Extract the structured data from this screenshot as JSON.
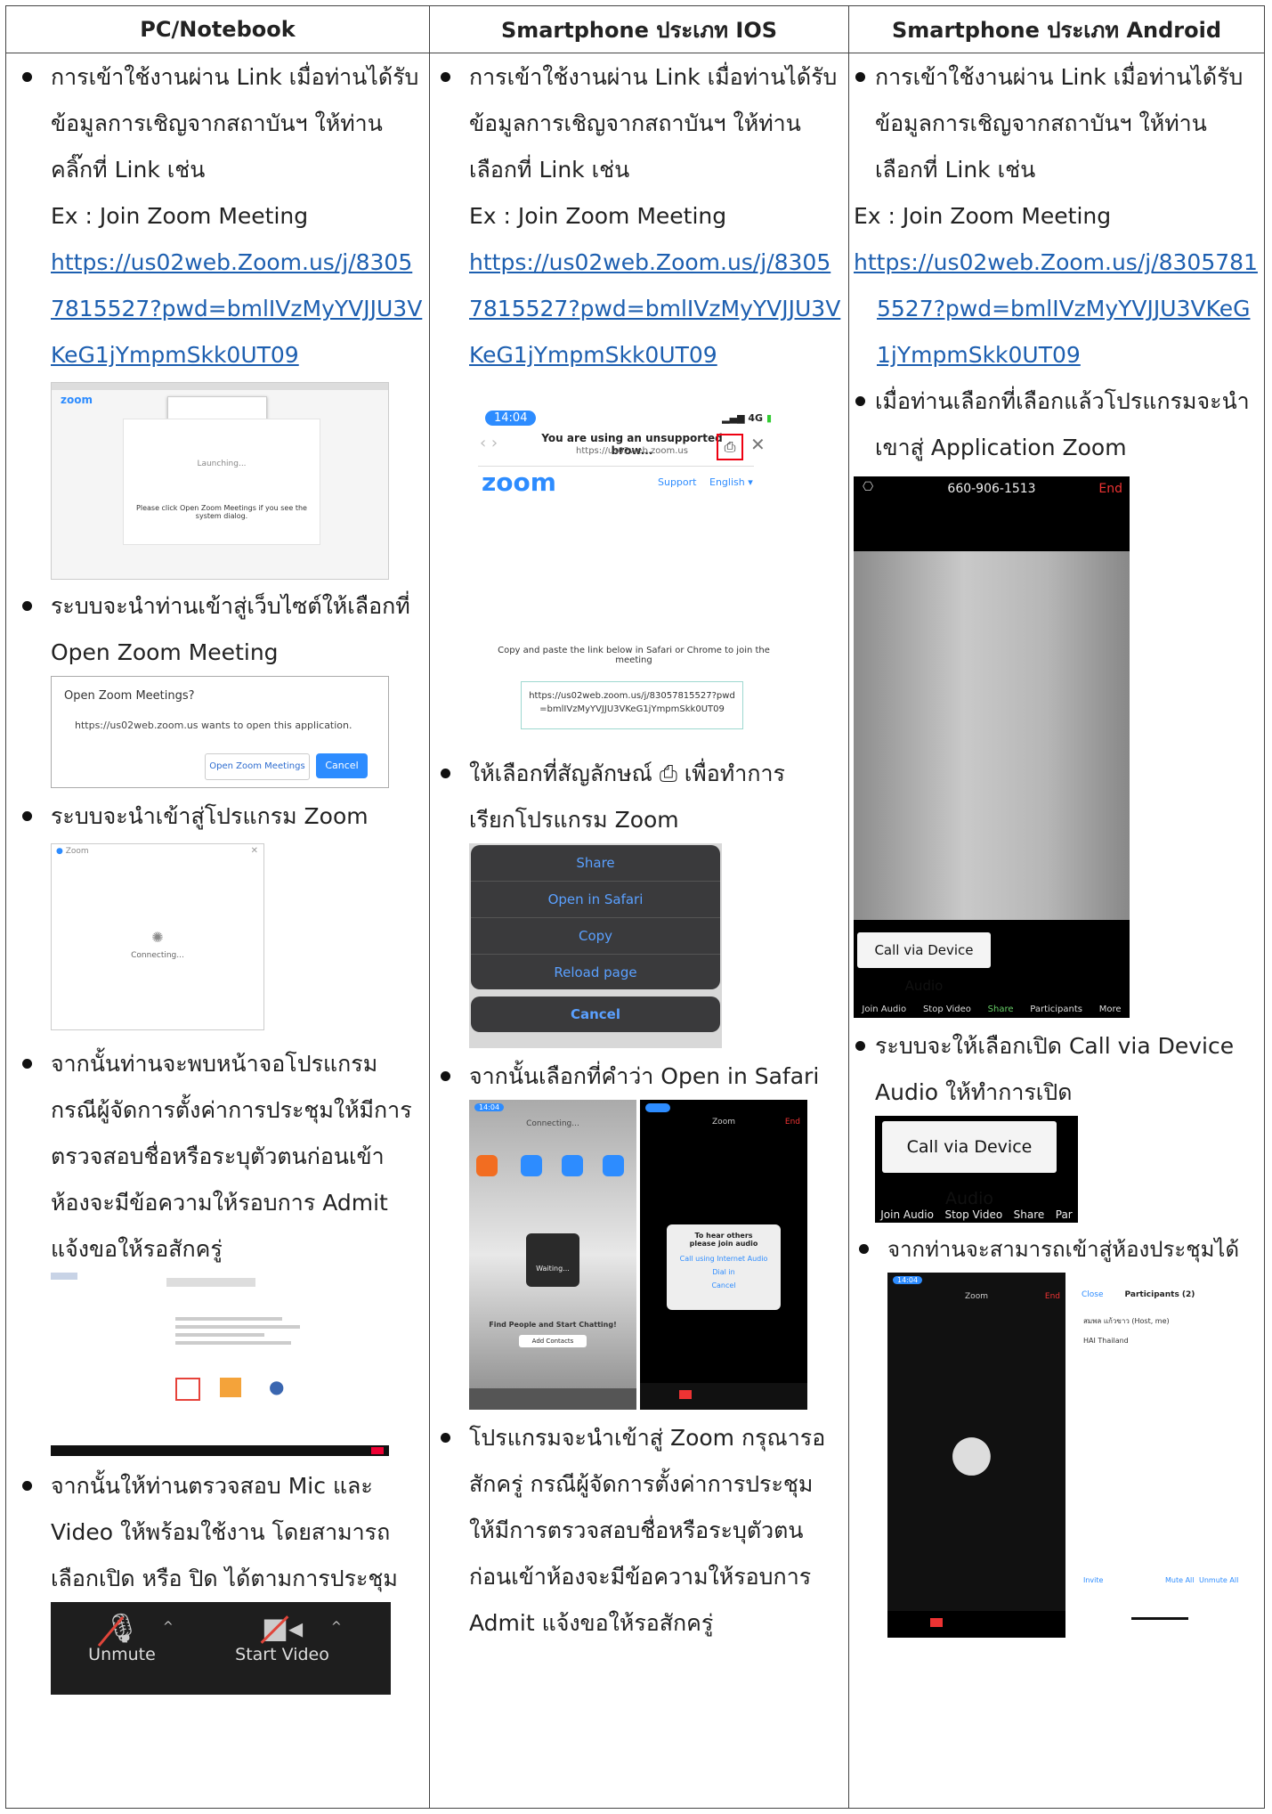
{
  "headers": [
    "PC/Notebook",
    "Smartphone ประเภท IOS",
    "Smartphone ประเภท Android"
  ],
  "pc": {
    "step1": [
      "การเข้าใช้งานผ่าน Link เมื่อท่านได้รับ",
      "ข้อมูลการเชิญจากสถาบันฯ ให้ท่าน",
      "คลิ๊กที่ Link เช่น",
      "Ex : Join Zoom Meeting"
    ],
    "link": [
      "https://us02web.Zoom.us/j/8305",
      "7815527?pwd=bmlIVzMyYVJJU3V",
      "KeG1jYmpmSkk0UT09"
    ],
    "shot1": {
      "logo": "zoom",
      "launching": "Launching...",
      "instruction": "Please click Open Zoom Meetings if you see the system dialog."
    },
    "step2": [
      "ระบบจะนำท่านเข้าสู่เว็บไซต์ให้เลือกที่",
      "Open Zoom Meeting"
    ],
    "dialog": {
      "title": "Open Zoom Meetings?",
      "message": "https://us02web.zoom.us wants to open this application.",
      "open": "Open Zoom Meetings",
      "cancel": "Cancel"
    },
    "step3": [
      "ระบบจะนำเข้าสู่โปรแกรม Zoom"
    ],
    "connect": {
      "title": "Zoom",
      "status": "Connecting..."
    },
    "step4": [
      "จากนั้นท่านจะพบหน้าจอโปรแกรม",
      "กรณีผู้จัดการตั้งค่าการประชุมให้มีการ",
      "ตรวจสอบชื่อหรือระบุตัวตนก่อนเข้า",
      "ห้องจะมีข้อความให้รอบการ Admit",
      "แจ้งขอให้รอสักครู่"
    ],
    "step5": [
      "จากนั้นให้ท่านตรวจสอบ Mic และ",
      "Video ให้พร้อมใช้งาน โดยสามารถ",
      "เลือกเปิด หรือ ปิด ได้ตามการประชุม"
    ],
    "controls": {
      "unmute": "Unmute",
      "start_video": "Start Video"
    }
  },
  "ios": {
    "step1": [
      "การเข้าใช้งานผ่าน Link เมื่อท่านได้รับ",
      "ข้อมูลการเชิญจากสถาบันฯ ให้ท่าน",
      "เลือกที่ Link เช่น",
      "Ex : Join Zoom Meeting"
    ],
    "link": [
      "https://us02web.Zoom.us/j/8305",
      "7815527?pwd=bmlIVzMyYVJJU3V",
      "KeG1jYmpmSkk0UT09"
    ],
    "browser": {
      "time": "14:04",
      "signal": "4G",
      "unsupported": "You are using an unsupported brow...",
      "url": "https://us02web.zoom.us",
      "logo": "zoom",
      "support": "Support",
      "english": "English ▾",
      "copy_text": "Copy and paste the link below in Safari or Chrome to join the meeting",
      "meeting_link": "https://us02web.zoom.us/j/83057815527?pwd=bmlIVzMyYVJJU3VKeG1jYmpmSkk0UT09"
    },
    "step2": [
      "ให้เลือกที่สัญลักษณ์ ⎙  เพื่อทำการ",
      "เรียกโปรแกรม Zoom"
    ],
    "share_menu": [
      "Share",
      "Open in Safari",
      "Copy",
      "Reload page"
    ],
    "share_cancel": "Cancel",
    "step3": [
      "จากนั้นเลือกที่คำว่า Open in Safari"
    ],
    "waiting": {
      "connecting": "Connecting...",
      "waiting": "Waiting...",
      "find": "Find People and Start Chatting!",
      "add": "Add Contacts",
      "zoom": "Zoom",
      "end": "End",
      "hear1": "To hear others",
      "hear2": "please join audio",
      "call": "Call using Internet Audio",
      "dial": "Dial in",
      "cancel": "Cancel"
    },
    "step4": [
      "โปรแกรมจะนำเข้าสู่ Zoom กรุณารอ",
      "สักครู่ กรณีผู้จัดการตั้งค่าการประชุม",
      "ให้มีการตรวจสอบชื่อหรือระบุตัวตน",
      "ก่อนเข้าห้องจะมีข้อความให้รอบการ",
      "Admit แจ้งขอให้รอสักครู่"
    ]
  },
  "android": {
    "step1": [
      "การเข้าใช้งานผ่าน Link เมื่อท่านได้รับ",
      "ข้อมูลการเชิญจากสถาบันฯ ให้ท่าน",
      "เลือกที่ Link เช่น"
    ],
    "ex": "Ex : Join Zoom Meeting",
    "link": [
      "https://us02web.Zoom.us/j/8305781",
      "5527?pwd=bmlIVzMyYVJJU3VKeG",
      "1jYmpmSkk0UT09"
    ],
    "step2": [
      "เมื่อท่านเลือกที่เลือกแล้วโปรแกรมจะนำ",
      "เขาสู่ Application Zoom"
    ],
    "call": {
      "number": "660-906-1513",
      "end": "End",
      "call_audio": "Call via Device Audio",
      "join_audio": "Join Audio",
      "stop_video": "Stop Video",
      "share": "Share",
      "participants": "Participants",
      "more": "More"
    },
    "step3": [
      "ระบบจะให้เลือกเปิด  Call via Device",
      "Audio ให้ทำการเปิด"
    ],
    "crop": {
      "call_audio": "Call via Device Audio",
      "join_audio": "Join Audio",
      "stop_video": "Stop Video",
      "share": "Share",
      "par": "Par"
    },
    "step4": [
      "จากท่านจะสามารถเข้าสู่ห้องประชุมได้"
    ],
    "room": {
      "time": "14:04",
      "zoom": "Zoom",
      "end": "End",
      "close": "Close",
      "participants": "Participants (2)",
      "p1": "สมพล แก้วขาว (Host, me)",
      "p2": "HAI Thailand",
      "invite": "Invite",
      "mute_all": "Mute All",
      "unmute_all": "Unmute All"
    }
  }
}
